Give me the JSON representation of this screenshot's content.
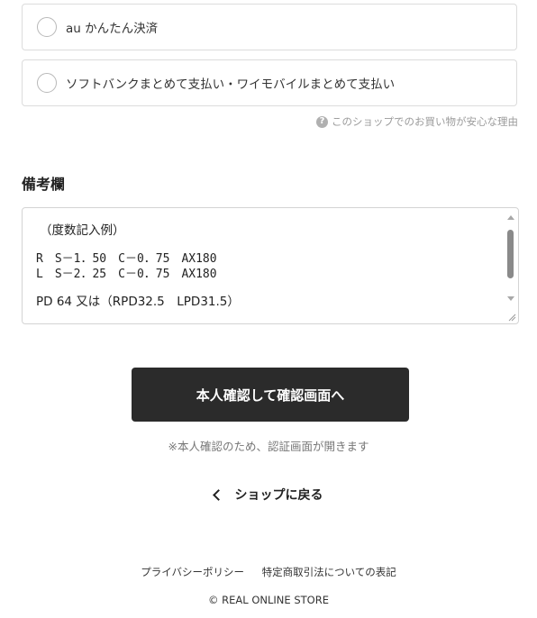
{
  "payment_options": [
    {
      "label": "au かんたん決済"
    },
    {
      "label": "ソフトバンクまとめて支払い・ワイモバイルまとめて支払い"
    }
  ],
  "reason_link": {
    "icon": "question-circle-icon",
    "text": "このショップでのお買い物が安心な理由"
  },
  "remarks": {
    "title": "備考欄",
    "lines": [
      "（度数記入例）",
      "R　S－1．50　C－0．75　AX180",
      "L　S－2．25　C－0．75　AX180",
      "PD 64 又は（RPD32.5　LPD31.5）"
    ]
  },
  "confirm_button": {
    "label": "本人確認して確認画面へ"
  },
  "notice": "※本人確認のため、認証画面が開きます",
  "back_link": {
    "icon": "chevron-left-icon",
    "label": "ショップに戻る"
  },
  "footer": {
    "privacy": "プライバシーポリシー",
    "legal": "特定商取引法についての表記",
    "copyright": "© REAL ONLINE STORE"
  },
  "colors": {
    "button_bg": "#2b2b2b",
    "border": "#dcdcdc",
    "muted_text": "#9b9b9b"
  }
}
